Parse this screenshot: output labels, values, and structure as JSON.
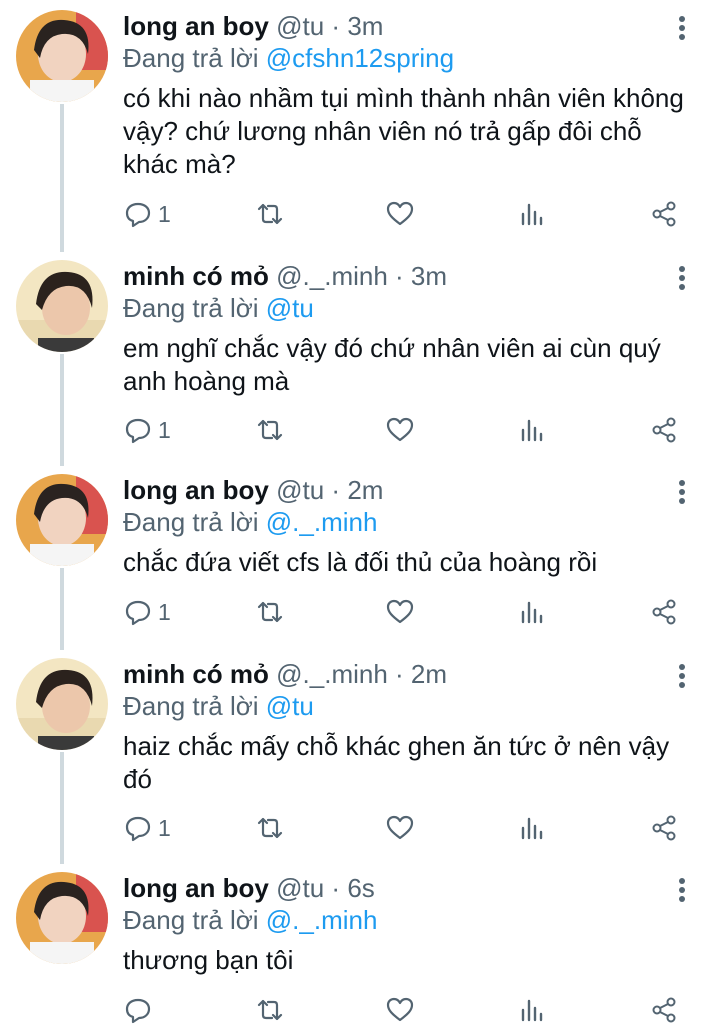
{
  "tweets": [
    {
      "name": "long an boy",
      "handle": "@tu",
      "time": "3m",
      "reply_prefix": "Đang trả lời ",
      "reply_to": "@cfshn12spring",
      "text": "có khi nào nhầm tụi mình thành nhân viên không vậy? chứ lương nhân viên nó trả gấp đôi chỗ khác mà?",
      "reply_count": "1"
    },
    {
      "name": "minh có mỏ",
      "handle": "@._.minh",
      "time": "3m",
      "reply_prefix": "Đang trả lời ",
      "reply_to": "@tu",
      "text": "em nghĩ chắc vậy đó chứ nhân viên ai cùn quý anh hoàng mà",
      "reply_count": "1"
    },
    {
      "name": "long an boy",
      "handle": "@tu",
      "time": "2m",
      "reply_prefix": "Đang trả lời ",
      "reply_to": "@._.minh",
      "text": "chắc đứa viết cfs là đối thủ của hoàng rồi",
      "reply_count": "1"
    },
    {
      "name": "minh có mỏ",
      "handle": "@._.minh",
      "time": "2m",
      "reply_prefix": "Đang trả lời ",
      "reply_to": "@tu",
      "text": "haiz chắc mấy chỗ khác ghen ăn tức ở nên vậy đó",
      "reply_count": "1"
    },
    {
      "name": "long an boy",
      "handle": "@tu",
      "time": "6s",
      "reply_prefix": "Đang trả lời ",
      "reply_to": "@._.minh",
      "text": "thương bạn tôi",
      "reply_count": ""
    }
  ],
  "separator": " · ",
  "icons": [
    "more-icon",
    "reply-icon",
    "retweet-icon",
    "like-icon",
    "stats-icon",
    "share-icon"
  ],
  "colors": {
    "text": "#0f1419",
    "secondary": "#536471",
    "link": "#1d9bf0",
    "thread_line": "#cfd9de"
  }
}
